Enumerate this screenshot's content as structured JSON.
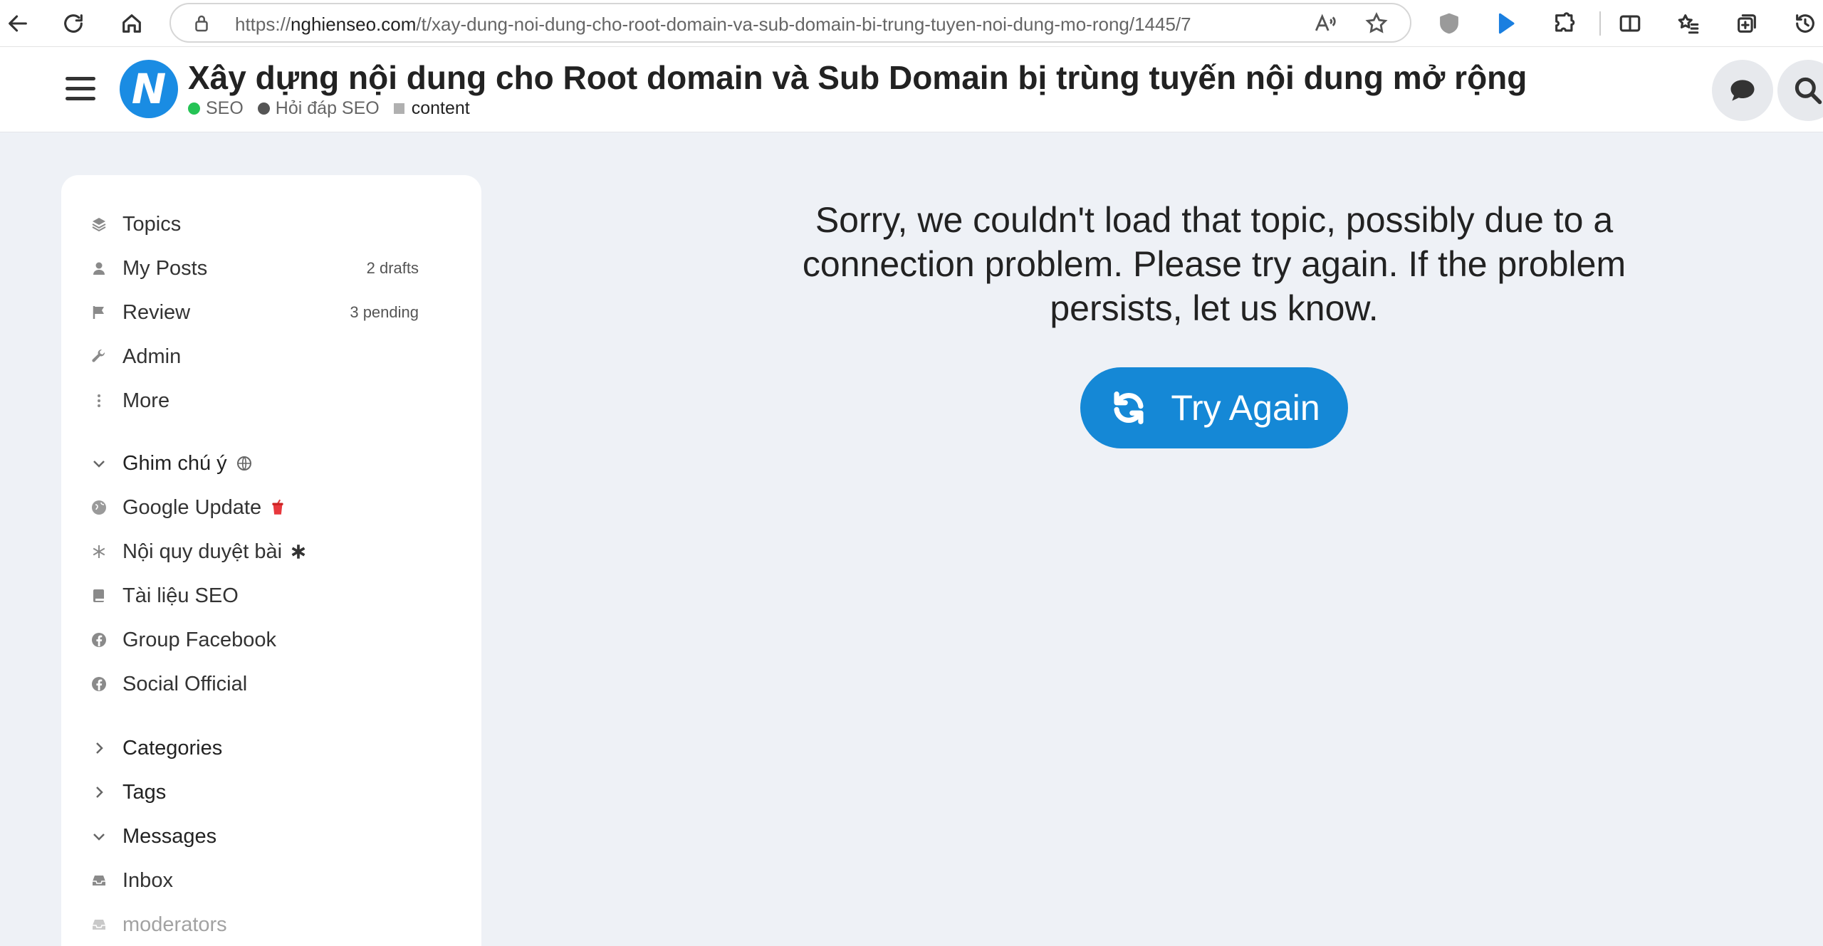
{
  "browser": {
    "url_scheme": "https://",
    "url_host": "nghienseo.com",
    "url_path": "/t/xay-dung-noi-dung-cho-root-domain-va-sub-domain-bi-trung-tuyen-noi-dung-mo-rong/1445/7",
    "read_aloud_label": "A̅",
    "icons": [
      "back-icon",
      "refresh-icon",
      "home-icon",
      "lock-icon",
      "read-aloud-icon",
      "favorite-star-icon",
      "shield-extension-icon",
      "cursor-extension-icon",
      "extensions-puzzle-icon",
      "split-screen-icon",
      "favorites-icon",
      "collections-icon",
      "history-icon"
    ]
  },
  "header": {
    "title": "Xây dựng nội dung cho Root domain và Sub Domain bị trùng tuyến nội dung mở rộng",
    "logo_letter": "N",
    "breadcrumbs": [
      {
        "label": "SEO",
        "color": "#25c355"
      },
      {
        "label": "Hỏi đáp SEO",
        "color": "#555555"
      },
      {
        "label": "content",
        "color": "#b0b0b0"
      }
    ]
  },
  "sidebar": {
    "primary": [
      {
        "label": "Topics",
        "meta": "",
        "icon": "layers-icon"
      },
      {
        "label": "My Posts",
        "meta": "2 drafts",
        "icon": "user-icon"
      },
      {
        "label": "Review",
        "meta": "3 pending",
        "icon": "flag-icon"
      },
      {
        "label": "Admin",
        "meta": "",
        "icon": "wrench-icon"
      },
      {
        "label": "More",
        "meta": "",
        "icon": "ellipsis-vertical-icon"
      }
    ],
    "pinned_section": {
      "label": "Ghim chú ý",
      "icon": "globe-icon"
    },
    "pinned": [
      {
        "label": "Google Update",
        "icon": "globe-icon",
        "suffix_icon": "drink-cup-icon"
      },
      {
        "label": "Nội quy duyệt bài",
        "icon": "asterisk-icon",
        "suffix_icon": "asterisk-bold-icon"
      },
      {
        "label": "Tài liệu SEO",
        "icon": "book-icon"
      },
      {
        "label": "Group Facebook",
        "icon": "facebook-icon"
      },
      {
        "label": "Social Official",
        "icon": "facebook-icon"
      }
    ],
    "sections": [
      {
        "label": "Categories",
        "expanded": false
      },
      {
        "label": "Tags",
        "expanded": false
      },
      {
        "label": "Messages",
        "expanded": true
      }
    ],
    "messages": [
      {
        "label": "Inbox",
        "icon": "inbox-icon"
      },
      {
        "label": "moderators",
        "icon": "inbox-icon"
      }
    ]
  },
  "main": {
    "error_message": "Sorry, we couldn't load that topic, possibly due to a connection problem. Please try again. If the problem persists, let us know.",
    "retry_label": "Try Again"
  },
  "colors": {
    "accent": "#1588d6",
    "page_bg": "#eef1f6",
    "seo_category": "#25c355"
  }
}
